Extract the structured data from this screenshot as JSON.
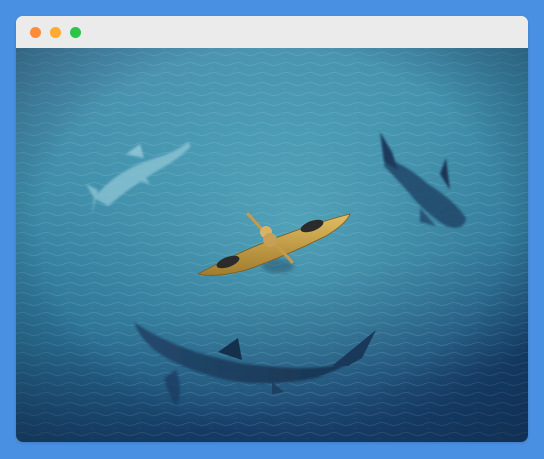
{
  "window": {
    "controls": {
      "close_color": "#ff8c3a",
      "minimize_color": "#ffaa33",
      "maximize_color": "#2ec44a"
    }
  },
  "photo": {
    "subject": [
      "kayak-icon",
      "shark-icon"
    ],
    "colors": {
      "water_light": "#5aa6c0",
      "water_mid": "#2f7f9c",
      "water_deep": "#153f6b",
      "kayak": "#c9a24a",
      "shark": "#1b3550"
    }
  }
}
